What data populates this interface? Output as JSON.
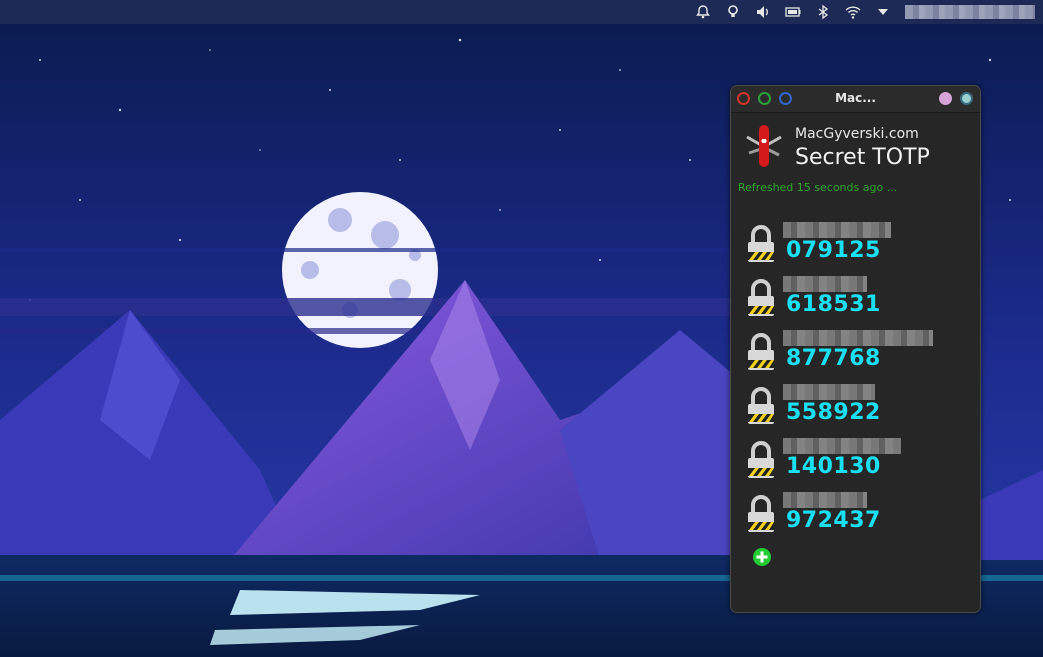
{
  "window": {
    "title": "Mac...",
    "brand": "MacGyverski.com",
    "app_title": "Secret TOTP",
    "refresh_status": "Refreshed 15 seconds ago ..."
  },
  "entries": [
    {
      "code": "079125"
    },
    {
      "code": "618531"
    },
    {
      "code": "877768"
    },
    {
      "code": "558922"
    },
    {
      "code": "140130"
    },
    {
      "code": "972437"
    }
  ],
  "icons": {
    "tray": [
      "alarm-icon",
      "bulb-icon",
      "volume-icon",
      "battery-icon",
      "bluetooth-icon",
      "wifi-icon",
      "dropdown-icon"
    ],
    "lock": "padlock-icon",
    "logo": "swiss-knife-icon",
    "add": "add-icon"
  },
  "colors": {
    "code": "#19e0f2",
    "refresh": "#2fa82f",
    "add": "#22cc33"
  }
}
